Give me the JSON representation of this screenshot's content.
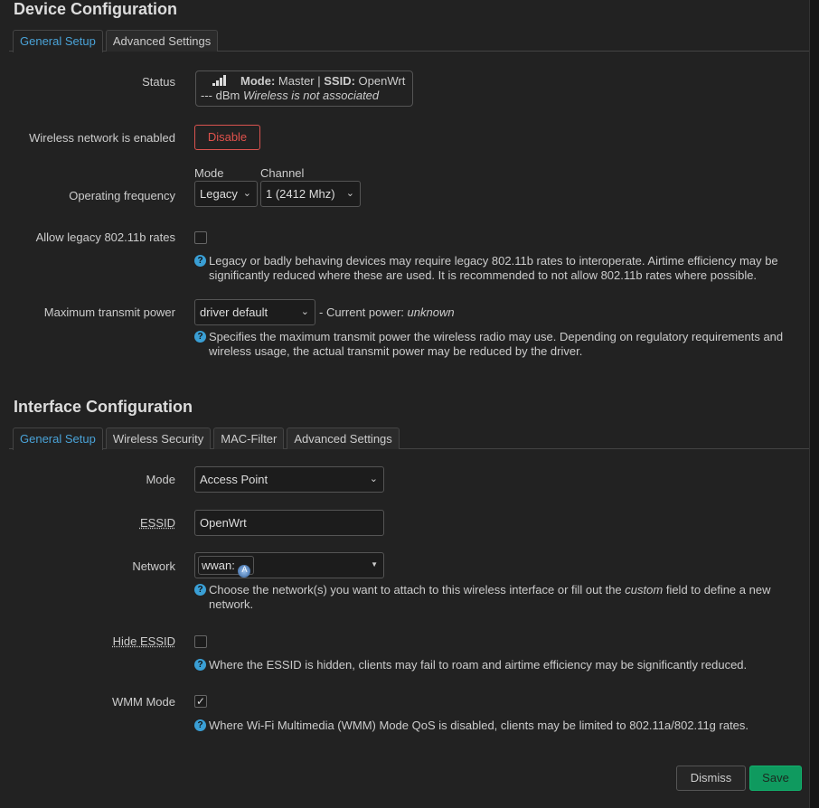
{
  "device": {
    "title": "Device Configuration",
    "tabs": [
      {
        "label": "General Setup",
        "active": true
      },
      {
        "label": "Advanced Settings",
        "active": false
      }
    ],
    "status_label": "Status",
    "status": {
      "mode_key": "Mode:",
      "mode": "Master",
      "ssid_key": "SSID:",
      "ssid": "OpenWrt",
      "dbm": "--- dBm",
      "assoc": "Wireless is not associated",
      "signal_icon": "signal-bars-icon"
    },
    "enabled_label": "Wireless network is enabled",
    "disable_button": "Disable",
    "freq_label": "Operating frequency",
    "mode_header": "Mode",
    "channel_header": "Channel",
    "mode_value": "Legacy",
    "channel_value": "1 (2412 Mhz)",
    "legacy_label": "Allow legacy 802.11b rates",
    "legacy_checked": false,
    "legacy_help": "Legacy or badly behaving devices may require legacy 802.11b rates to interoperate. Airtime efficiency may be significantly reduced where these are used. It is recommended to not allow 802.11b rates where possible.",
    "txpower_label": "Maximum transmit power",
    "txpower_value": "driver default",
    "current_power_prefix": "- Current power:",
    "current_power": "unknown",
    "txpower_help": "Specifies the maximum transmit power the wireless radio may use. Depending on regulatory requirements and wireless usage, the actual transmit power may be reduced by the driver."
  },
  "iface": {
    "title": "Interface Configuration",
    "tabs": [
      {
        "label": "General Setup",
        "active": true
      },
      {
        "label": "Wireless Security",
        "active": false
      },
      {
        "label": "MAC-Filter",
        "active": false
      },
      {
        "label": "Advanced Settings",
        "active": false
      }
    ],
    "mode_label": "Mode",
    "mode_value": "Access Point",
    "essid_label": "ESSID",
    "essid_value": "OpenWrt",
    "network_label": "Network",
    "network_value": "wwan:",
    "network_help_a": "Choose the network(s) you want to attach to this wireless interface or fill out the",
    "network_help_em": "custom",
    "network_help_b": "field to define a new network.",
    "hide_label": "Hide ESSID",
    "hide_checked": false,
    "hide_help": "Where the ESSID is hidden, clients may fail to roam and airtime efficiency may be significantly reduced.",
    "wmm_label": "WMM Mode",
    "wmm_checked": true,
    "wmm_help": "Where Wi-Fi Multimedia (WMM) Mode QoS is disabled, clients may be limited to 802.11a/802.11g rates."
  },
  "footer": {
    "dismiss": "Dismiss",
    "save": "Save"
  },
  "colors": {
    "accent": "#4aa3d8",
    "danger": "#d9534f",
    "save": "#0f9a5f"
  }
}
